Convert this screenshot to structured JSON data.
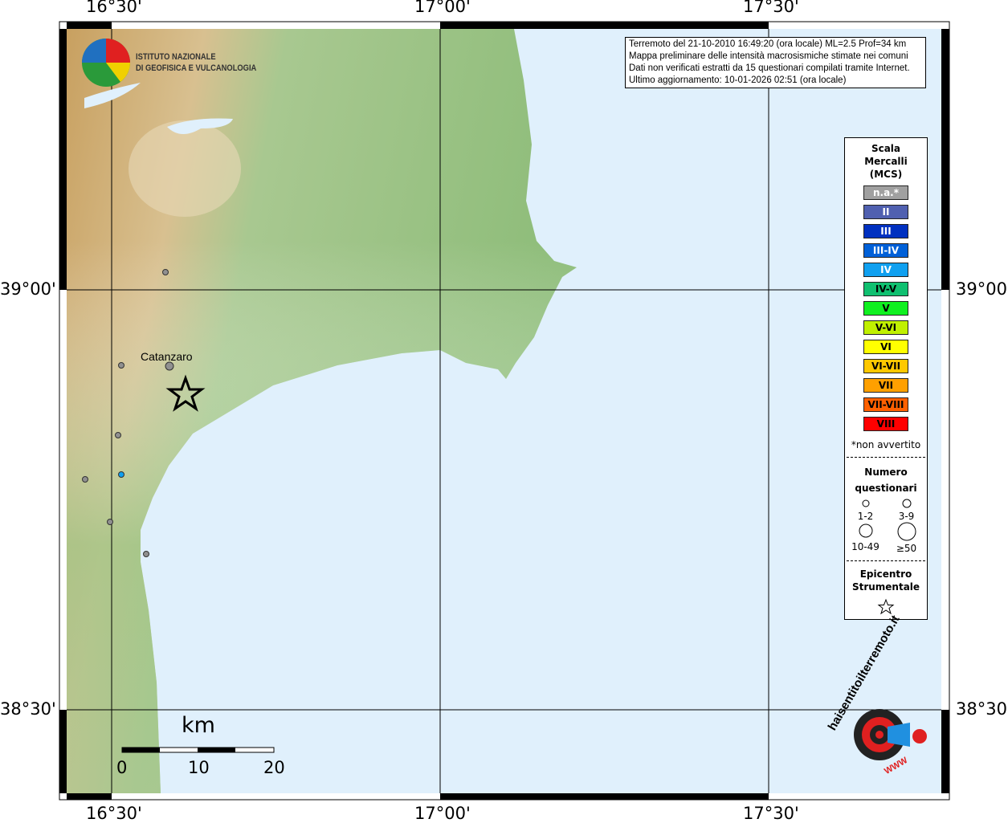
{
  "axes": {
    "top": [
      "16°30'",
      "17°00'",
      "17°30'"
    ],
    "bottom": [
      "16°30'",
      "17°00'",
      "17°30'"
    ],
    "left": [
      "39°00'",
      "38°30'"
    ],
    "right": [
      "39°00'",
      "38°30'"
    ]
  },
  "logo": {
    "line1": "ISTITUTO NAZIONALE",
    "line2": "DI GEOFISICA E VULCANOLOGIA"
  },
  "info": [
    "Terremoto del 21-10-2010 16:49:20 (ora locale) ML=2.5 Prof=34 km",
    "Mappa preliminare delle intensità macrosismiche stimate nei comuni",
    "Dati non verificati estratti da 15 questionari compilati tramite Internet.",
    "Ultimo aggiornamento: 10-01-2026 02:51 (ora locale)"
  ],
  "city": "Catanzaro",
  "scale_bar": {
    "unit": "km",
    "labels": [
      "0",
      "10",
      "20"
    ]
  },
  "legend": {
    "title": [
      "Scala",
      "Mercalli",
      "(MCS)"
    ],
    "classes": [
      {
        "label": "n.a.*",
        "color": "#a0a0a0",
        "text": "#fff"
      },
      {
        "label": "II",
        "color": "#5060b0",
        "text": "#fff"
      },
      {
        "label": "III",
        "color": "#0030c0",
        "text": "#fff"
      },
      {
        "label": "III-IV",
        "color": "#0060d8",
        "text": "#fff"
      },
      {
        "label": "IV",
        "color": "#10a0f0",
        "text": "#fff"
      },
      {
        "label": "IV-V",
        "color": "#10c070",
        "text": "#000"
      },
      {
        "label": "V",
        "color": "#10f020",
        "text": "#000"
      },
      {
        "label": "V-VI",
        "color": "#c0f000",
        "text": "#000"
      },
      {
        "label": "VI",
        "color": "#ffff00",
        "text": "#000"
      },
      {
        "label": "VI-VII",
        "color": "#ffc800",
        "text": "#000"
      },
      {
        "label": "VII",
        "color": "#ffa000",
        "text": "#000"
      },
      {
        "label": "VII-VIII",
        "color": "#ff6000",
        "text": "#000"
      },
      {
        "label": "VIII",
        "color": "#ff0000",
        "text": "#000"
      }
    ],
    "note": "*non avvertito",
    "count_title": [
      "Numero",
      "questionari"
    ],
    "counts": [
      "1-2",
      "3-9",
      "10-49",
      "≥50"
    ],
    "epi_title": [
      "Epicentro",
      "Strumentale"
    ]
  },
  "brand": {
    "text": "haisentitoilterremoto.it",
    "url": "WWW"
  },
  "colors": {
    "sea": "#e0f0fc",
    "dot_gray": "#909090",
    "dot_blue": "#10a0f0"
  }
}
